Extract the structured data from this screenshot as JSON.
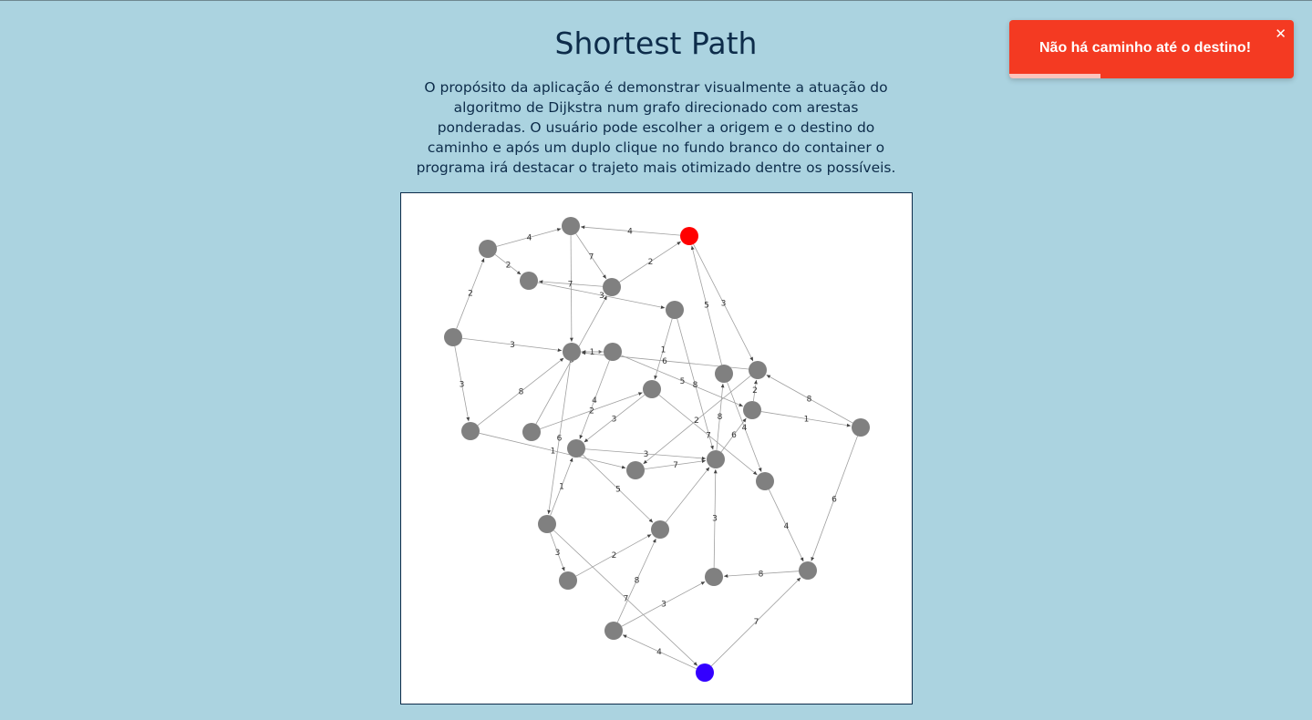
{
  "header": {
    "title": "Shortest Path",
    "description": "O propósito da aplicação é demonstrar visualmente a atuação do algoritmo de Dijkstra num grafo direcionado com arestas ponderadas. O usuário pode escolher a origem e o destino do caminho e após um duplo clique no fundo branco do container o programa irá destacar o trajeto mais otimizado dentre os possíveis."
  },
  "toast": {
    "message": "Não há caminho até o destino!",
    "close_icon": "close-icon",
    "progress": 0.32,
    "color": "#f43a22"
  },
  "graph": {
    "colors": {
      "node": "#808080",
      "origin": "#ff0000",
      "destination": "#3300ff",
      "edge": "#a0a0a0"
    },
    "nodes": [
      {
        "id": "n0"
      },
      {
        "id": "n1"
      },
      {
        "id": "n2",
        "role": "origin"
      },
      {
        "id": "n3"
      },
      {
        "id": "n4"
      },
      {
        "id": "n5"
      },
      {
        "id": "n6"
      },
      {
        "id": "n7"
      },
      {
        "id": "n8"
      },
      {
        "id": "n9"
      },
      {
        "id": "n10"
      },
      {
        "id": "n11"
      },
      {
        "id": "n12"
      },
      {
        "id": "n13"
      },
      {
        "id": "n14"
      },
      {
        "id": "n15"
      },
      {
        "id": "n16"
      },
      {
        "id": "n17"
      },
      {
        "id": "n18"
      },
      {
        "id": "n19"
      },
      {
        "id": "n20"
      },
      {
        "id": "n21"
      },
      {
        "id": "n22"
      },
      {
        "id": "n23"
      },
      {
        "id": "n24"
      },
      {
        "id": "n25"
      },
      {
        "id": "n26"
      },
      {
        "id": "n27",
        "role": "destination"
      }
    ],
    "edges": [
      {
        "from": "n0",
        "to": "n1",
        "w": "4"
      },
      {
        "from": "n2",
        "to": "n1",
        "w": "4"
      },
      {
        "from": "n0",
        "to": "n3",
        "w": "2"
      },
      {
        "from": "n1",
        "to": "n4",
        "w": "7"
      },
      {
        "from": "n4",
        "to": "n2",
        "w": "2"
      },
      {
        "from": "n4",
        "to": "n3",
        "w": "7"
      },
      {
        "from": "n3",
        "to": "n5",
        "w": "3"
      },
      {
        "from": "n6",
        "to": "n0",
        "w": "2"
      },
      {
        "from": "n6",
        "to": "n8",
        "w": "3"
      },
      {
        "from": "n6",
        "to": "n13",
        "w": "3"
      },
      {
        "from": "n1",
        "to": "n8",
        "w": ""
      },
      {
        "from": "n8",
        "to": "n9",
        "w": "1"
      },
      {
        "from": "n9",
        "to": "n8",
        "w": ""
      },
      {
        "from": "n2",
        "to": "n11",
        "w": "3"
      },
      {
        "from": "n10",
        "to": "n2",
        "w": "5"
      },
      {
        "from": "n5",
        "to": "n12",
        "w": "1"
      },
      {
        "from": "n11",
        "to": "n8",
        "w": "6"
      },
      {
        "from": "n9",
        "to": "n15",
        "w": "5"
      },
      {
        "from": "n13",
        "to": "n8",
        "w": "8"
      },
      {
        "from": "n14",
        "to": "n4",
        "w": "5"
      },
      {
        "from": "n9",
        "to": "n16",
        "w": "4"
      },
      {
        "from": "n14",
        "to": "n12",
        "w": "2"
      },
      {
        "from": "n12",
        "to": "n16",
        "w": "3"
      },
      {
        "from": "n12",
        "to": "n21",
        "w": "7"
      },
      {
        "from": "n17",
        "to": "n11",
        "w": "8"
      },
      {
        "from": "n15",
        "to": "n17",
        "w": "1"
      },
      {
        "from": "n15",
        "to": "n11",
        "w": "2"
      },
      {
        "from": "n5",
        "to": "n18",
        "w": "8"
      },
      {
        "from": "n18",
        "to": "n10",
        "w": "8"
      },
      {
        "from": "n18",
        "to": "n15",
        "w": "6"
      },
      {
        "from": "n13",
        "to": "n19",
        "w": "1"
      },
      {
        "from": "n16",
        "to": "n18",
        "w": "3"
      },
      {
        "from": "n19",
        "to": "n18",
        "w": "7"
      },
      {
        "from": "n11",
        "to": "n19",
        "w": "2"
      },
      {
        "from": "n10",
        "to": "n21",
        "w": "4"
      },
      {
        "from": "n20",
        "to": "n16",
        "w": "1"
      },
      {
        "from": "n8",
        "to": "n20",
        "w": "6"
      },
      {
        "from": "n16",
        "to": "n22",
        "w": "5"
      },
      {
        "from": "n23",
        "to": "n18",
        "w": "3"
      },
      {
        "from": "n21",
        "to": "n25",
        "w": "4"
      },
      {
        "from": "n17",
        "to": "n25",
        "w": "6"
      },
      {
        "from": "n25",
        "to": "n23",
        "w": "8"
      },
      {
        "from": "n20",
        "to": "n24",
        "w": "3"
      },
      {
        "from": "n24",
        "to": "n22",
        "w": "2"
      },
      {
        "from": "n26",
        "to": "n22",
        "w": "8"
      },
      {
        "from": "n26",
        "to": "n23",
        "w": "3"
      },
      {
        "from": "n20",
        "to": "n27",
        "w": "7"
      },
      {
        "from": "n27",
        "to": "n26",
        "w": "4"
      },
      {
        "from": "n27",
        "to": "n25",
        "w": "7"
      },
      {
        "from": "n22",
        "to": "n18",
        "w": ""
      }
    ]
  }
}
